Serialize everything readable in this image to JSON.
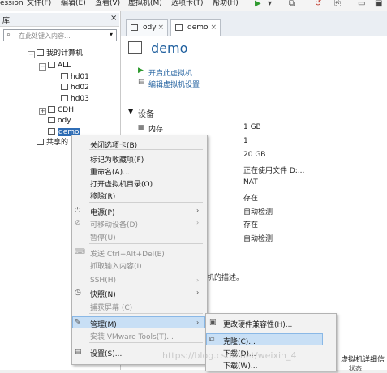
{
  "menubar": {
    "items": [
      "ession",
      "文件(F)",
      "编辑(E)",
      "查看(V)",
      "虚拟机(M)",
      "选项卡(T)",
      "帮助(H)"
    ]
  },
  "library": {
    "header": "库",
    "close": "×",
    "search_placeholder": "在此处键入内容...",
    "tree": [
      {
        "label": "我的计算机",
        "level": 0
      },
      {
        "label": "ALL",
        "level": 1
      },
      {
        "label": "hd01",
        "level": 2
      },
      {
        "label": "hd02",
        "level": 2
      },
      {
        "label": "hd03",
        "level": 2
      },
      {
        "label": "CDH",
        "level": 1
      },
      {
        "label": "ody",
        "level": 1
      },
      {
        "label": "demo",
        "level": 1,
        "selected": true
      },
      {
        "label": "共享的",
        "level": 0
      }
    ]
  },
  "tabs": [
    {
      "label": "ody",
      "close": "×"
    },
    {
      "label": "demo",
      "close": "×"
    }
  ],
  "vm": {
    "title": "demo",
    "actions": [
      "开启此虚拟机",
      "编辑虚拟机设置"
    ],
    "devices_header": "设备",
    "devices": [
      {
        "label": "内存",
        "value": "1 GB"
      },
      {
        "label": "",
        "value": "1"
      },
      {
        "label": "",
        "value": "20 GB"
      },
      {
        "label": "",
        "value": "正在使用文件 D:..."
      },
      {
        "label": "",
        "value": "NAT"
      },
      {
        "label": "",
        "value": "存在"
      },
      {
        "label": "",
        "value": "自动检测"
      },
      {
        "label": "",
        "value": "存在"
      },
      {
        "label": "",
        "value": "自动检测"
      }
    ],
    "description_fragment": "机的描述。",
    "details_fragment": "虚拟机详细信",
    "status_fragment": "状态"
  },
  "context_menu": {
    "items": [
      {
        "label": "关闭选项卡(B)",
        "disabled": false
      },
      {
        "label": "标记为收藏项(F)",
        "disabled": false
      },
      {
        "label": "重命名(A)...",
        "disabled": false
      },
      {
        "label": "打开虚拟机目录(O)",
        "disabled": false
      },
      {
        "label": "移除(R)",
        "disabled": false
      },
      {
        "label": "电源(P)",
        "disabled": false,
        "submenu": true,
        "icon": "power-icon"
      },
      {
        "label": "可移动设备(D)",
        "disabled": true,
        "submenu": true,
        "icon": "removable-icon"
      },
      {
        "label": "暂停(U)",
        "disabled": true
      },
      {
        "label": "发送 Ctrl+Alt+Del(E)",
        "disabled": true,
        "icon": "keyboard-icon"
      },
      {
        "label": "抓取输入内容(I)",
        "disabled": true
      },
      {
        "label": "SSH(H)",
        "disabled": true,
        "submenu": true
      },
      {
        "label": "快照(N)",
        "disabled": false,
        "submenu": true,
        "icon": "snapshot-icon"
      },
      {
        "label": "捕获屏幕 (C)",
        "disabled": true
      },
      {
        "label": "管理(M)",
        "disabled": false,
        "submenu": true,
        "highlighted": true,
        "icon": "wrench-icon"
      },
      {
        "label": "安装 VMware Tools(T)...",
        "disabled": true
      },
      {
        "label": "设置(S)...",
        "disabled": false,
        "icon": "settings-icon"
      }
    ],
    "submenu_arrow": "›"
  },
  "manage_submenu": {
    "items": [
      {
        "label": "更改硬件兼容性(H)...",
        "highlighted": false
      },
      {
        "label": "克隆(C)...",
        "highlighted": true
      },
      {
        "label": "下载(D)...",
        "highlighted": false
      },
      {
        "label": "下载(W)...",
        "highlighted": false
      }
    ]
  },
  "watermark": "https://blog.csdn.net/weixin_4"
}
